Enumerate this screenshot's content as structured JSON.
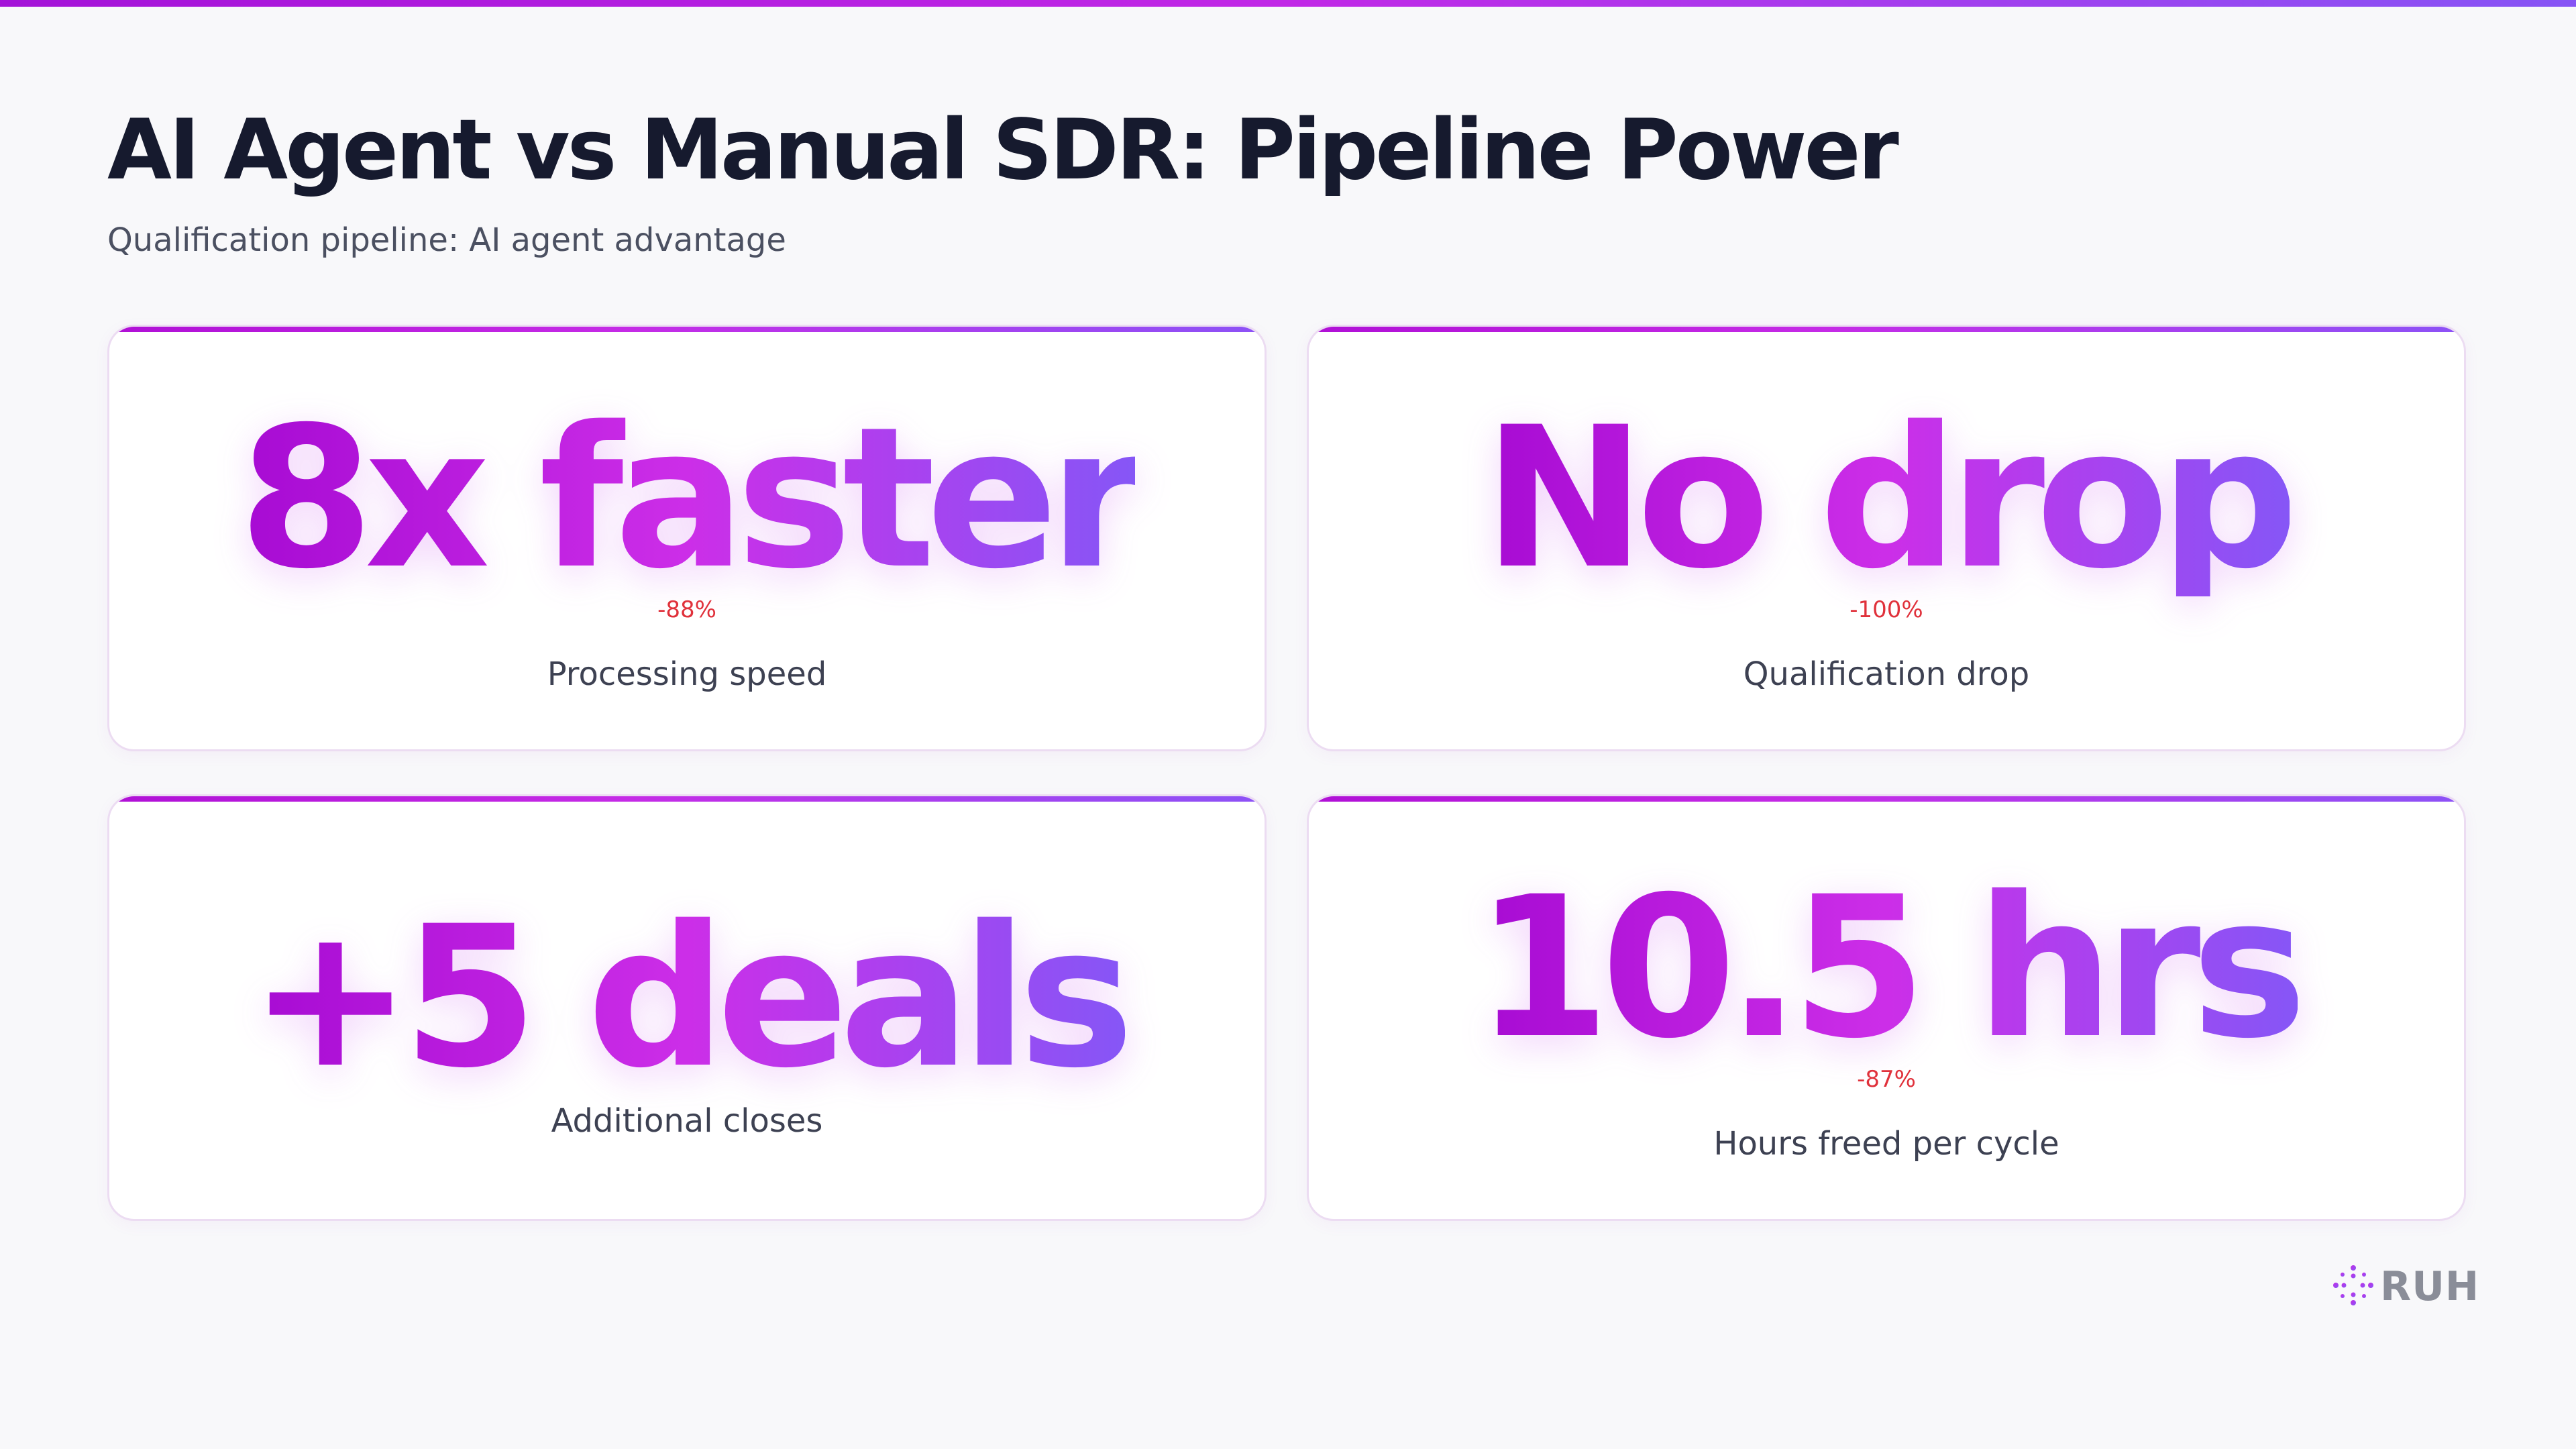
{
  "header": {
    "title": "AI Agent vs Manual SDR: Pipeline Power",
    "subtitle": "Qualification pipeline: AI agent advantage"
  },
  "cards": [
    {
      "metric": "8x faster",
      "change": "-88%",
      "label": "Processing speed"
    },
    {
      "metric": "No drop",
      "change": "-100%",
      "label": "Qualification drop"
    },
    {
      "metric": "+5 deals",
      "change": "",
      "label": "Additional closes"
    },
    {
      "metric": "10.5 hrs",
      "change": "-87%",
      "label": "Hours freed per cycle"
    }
  ],
  "brand": {
    "name": "RUH",
    "icon": "sparkle-dots-icon"
  },
  "colors": {
    "accent_start": "#a70bd3",
    "accent_mid": "#cc2ee8",
    "accent_end": "#8656f6",
    "negative_change": "#e0313b",
    "title": "#161a2e"
  }
}
